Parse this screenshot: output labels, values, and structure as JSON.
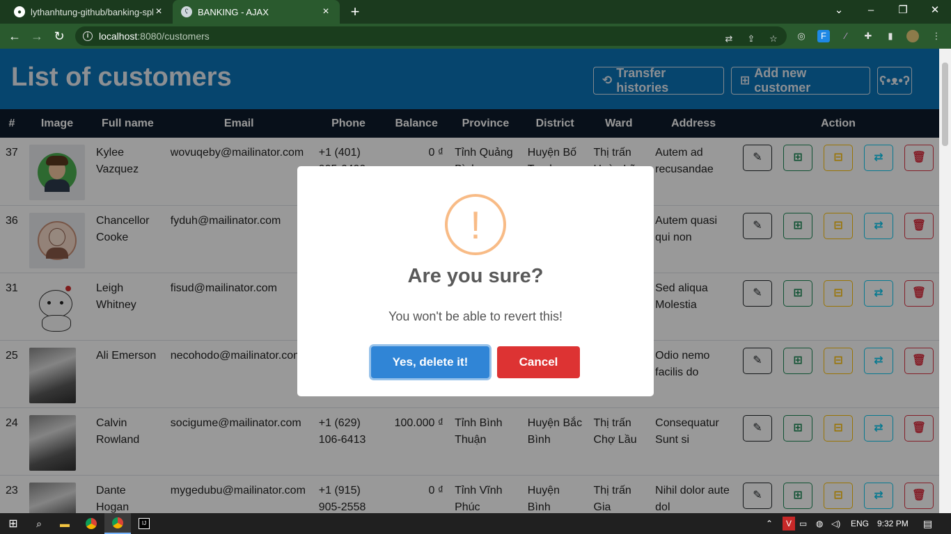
{
  "browser": {
    "tabs": [
      {
        "title": "lythanhtung-github/banking-spb",
        "icon": "github-icon",
        "active": false
      },
      {
        "title": "BANKING - AJAX",
        "icon": "bear-icon",
        "active": true
      }
    ],
    "url_host": "localhost",
    "url_path": ":8080/customers"
  },
  "header": {
    "title": "List of customers",
    "transfer_label": "Transfer histories",
    "add_label": "Add new customer"
  },
  "table": {
    "columns": [
      "#",
      "Image",
      "Full name",
      "Email",
      "Phone",
      "Balance",
      "Province",
      "District",
      "Ward",
      "Address",
      "Action"
    ],
    "rows": [
      {
        "id": "37",
        "name": "Kylee Vazquez",
        "email": "wovuqeby@mailinator.com",
        "phone": "+1 (401) 905-6499",
        "balance": "0 ₫",
        "province": "Tỉnh Quảng Bình",
        "district": "Huyện Bố Trạch",
        "ward": "Thị trấn Hoàn Lão",
        "address": "Autem ad recusandae",
        "image": "avatar-man"
      },
      {
        "id": "36",
        "name": "Chancellor Cooke",
        "email": "fyduh@mailinator.com",
        "phone": "",
        "balance": "",
        "province": "",
        "district": "",
        "ward": "",
        "address": "Autem quasi qui non",
        "image": "avatar-glasses"
      },
      {
        "id": "31",
        "name": "Leigh Whitney",
        "email": "fisud@mailinator.com",
        "phone": "",
        "balance": "",
        "province": "",
        "district": "",
        "ward": "",
        "address": "Sed aliqua Molestia",
        "image": "panda"
      },
      {
        "id": "25",
        "name": "Ali Emerson",
        "email": "necohodo@mailinator.com",
        "phone": "",
        "balance": "",
        "province": "",
        "district": "",
        "ward": "",
        "address": "Odio nemo facilis do",
        "image": "cat"
      },
      {
        "id": "24",
        "name": "Calvin Rowland",
        "email": "socigume@mailinator.com",
        "phone": "+1 (629) 106-6413",
        "balance": "100.000 ₫",
        "province": "Tỉnh Bình Thuận",
        "district": "Huyện Bắc Bình",
        "ward": "Thị trấn Chợ Lầu",
        "address": "Consequatur Sunt si",
        "image": "cat"
      },
      {
        "id": "23",
        "name": "Dante Hogan",
        "email": "mygedubu@mailinator.com",
        "phone": "+1 (915) 905-2558",
        "balance": "0 ₫",
        "province": "Tỉnh Vĩnh Phúc",
        "district": "Huyện Bình",
        "ward": "Thị trấn Gia Khánh",
        "address": "Nihil dolor aute dol",
        "image": "cat"
      }
    ]
  },
  "modal": {
    "icon": "!",
    "title": "Are you sure?",
    "text": "You won't be able to revert this!",
    "confirm_label": "Yes, delete it!",
    "cancel_label": "Cancel"
  },
  "taskbar": {
    "language": "ENG",
    "time": "9:32 PM"
  },
  "colors": {
    "header": "#0b74b8",
    "table_head": "#0e1c2c",
    "confirm": "#3085d6",
    "cancel": "#dd3333",
    "warning": "#f8bb86"
  }
}
